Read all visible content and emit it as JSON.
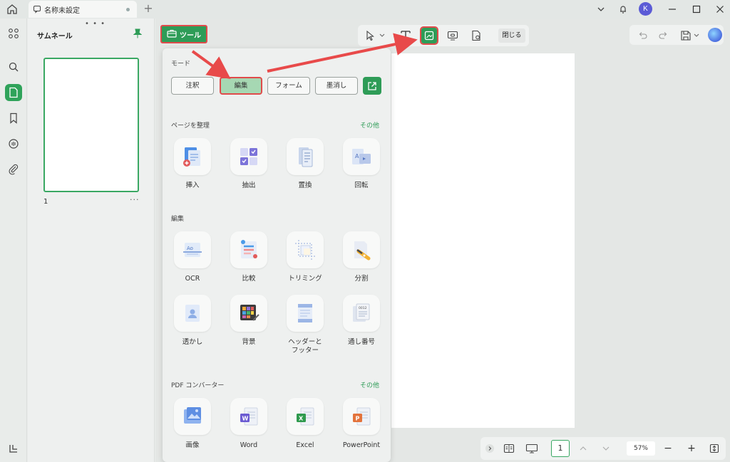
{
  "titlebar": {
    "tab_title": "名称未設定",
    "add_tab": "+",
    "avatar_letter": "K"
  },
  "thumbnails": {
    "title": "サムネール",
    "drag_dots": "• • •",
    "page_number": "1",
    "page_more": "···"
  },
  "header": {
    "tools_label": "ツール",
    "close_label": "閉じる"
  },
  "panel": {
    "mode_label": "モード",
    "modes": [
      "注釈",
      "編集",
      "フォーム",
      "墨消し"
    ],
    "active_mode": "編集",
    "organize_label": "ページを整理",
    "organize_more": "その他",
    "organize_items": [
      "挿入",
      "抽出",
      "置換",
      "回転"
    ],
    "edit_label": "編集",
    "edit_items": [
      "OCR",
      "比較",
      "トリミング",
      "分割",
      "透かし",
      "背景",
      "ヘッダーと\nフッター",
      "通し番号"
    ],
    "converter_label": "PDF コンバーター",
    "converter_more": "その他",
    "converter_items": [
      "画像",
      "Word",
      "Excel",
      "PowerPoint"
    ]
  },
  "bottombar": {
    "page": "1",
    "zoom": "57%",
    "minus": "−",
    "plus": "+"
  },
  "colors": {
    "accent": "#2e9c57",
    "highlight_border": "#e04b4b",
    "arrow": "#e84a4a"
  }
}
